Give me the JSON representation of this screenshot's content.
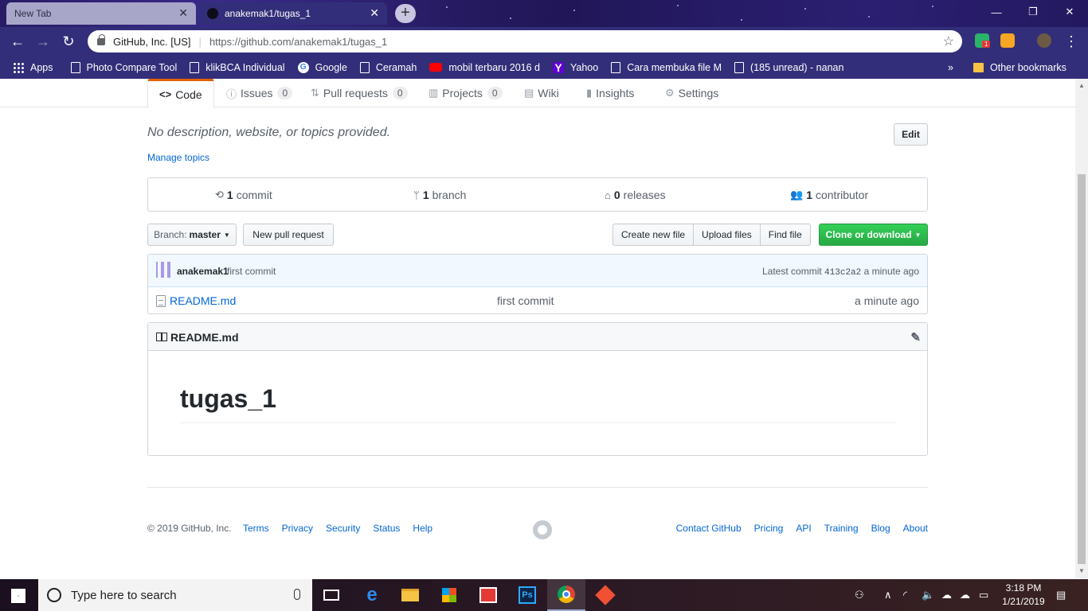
{
  "browser": {
    "tabs": [
      {
        "label": "New Tab",
        "active": false
      },
      {
        "label": "anakemak1/tugas_1",
        "active": true
      }
    ],
    "site_identity": "GitHub, Inc. [US]",
    "url": "https://github.com/anakemak1/tugas_1",
    "extension_badge": "1",
    "bookmarks": [
      "Apps",
      "Photo Compare Tool",
      "klikBCA Individual",
      "Google",
      "Ceramah",
      "mobil terbaru 2016 d",
      "Yahoo",
      "Cara membuka file M",
      "(185 unread) - nanan"
    ],
    "bookmarks_overflow": "»",
    "other_bookmarks": "Other bookmarks"
  },
  "repo_nav": {
    "code": "Code",
    "issues": "Issues",
    "issues_count": "0",
    "pulls": "Pull requests",
    "pulls_count": "0",
    "projects": "Projects",
    "projects_count": "0",
    "wiki": "Wiki",
    "insights": "Insights",
    "settings": "Settings"
  },
  "repo": {
    "description": "No description, website, or topics provided.",
    "edit_label": "Edit",
    "manage_topics": "Manage topics",
    "commits_count": "1",
    "commits_label": "commit",
    "branches_count": "1",
    "branches_label": "branch",
    "releases_count": "0",
    "releases_label": "releases",
    "contributors_count": "1",
    "contributors_label": "contributor"
  },
  "file_nav": {
    "branch_prefix": "Branch:",
    "branch_name": "master",
    "new_pull_request": "New pull request",
    "create_new_file": "Create new file",
    "upload_files": "Upload files",
    "find_file": "Find file",
    "clone_or_download": "Clone or download"
  },
  "latest_commit": {
    "author": "anakemak1",
    "message": "first commit",
    "prefix": "Latest commit",
    "sha": "413c2a2",
    "age": "a minute ago"
  },
  "files": [
    {
      "name": "README.md",
      "commit_message": "first commit",
      "age": "a minute ago"
    }
  ],
  "readme": {
    "filename": "README.md",
    "heading": "tugas_1"
  },
  "footer": {
    "copyright": "© 2019 GitHub, Inc.",
    "left_links": [
      "Terms",
      "Privacy",
      "Security",
      "Status",
      "Help"
    ],
    "right_links": [
      "Contact GitHub",
      "Pricing",
      "API",
      "Training",
      "Blog",
      "About"
    ]
  },
  "taskbar": {
    "search_placeholder": "Type here to search",
    "time": "3:18 PM",
    "date": "1/21/2019"
  },
  "colors": {
    "chrome_frame": "#332e79",
    "github_link": "#0366d6",
    "clone_button": "#28a745",
    "tab_underline": "#e36209"
  }
}
